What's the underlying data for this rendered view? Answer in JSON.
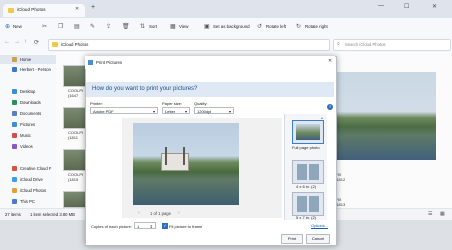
{
  "explorer": {
    "tab_title": "iCloud Photos",
    "toolbar": {
      "new_label": "New",
      "sort_label": "Sort",
      "view_label": "View",
      "set_background_label": "Set as background",
      "rotate_left_label": "Rotate left",
      "rotate_right_label": "Rotate right"
    },
    "address": "iCloud Photos",
    "search_placeholder": "Search iCloud Photos",
    "sidebar": [
      {
        "label": "Home",
        "color": "#c9a24b"
      },
      {
        "label": "Herbert - Person",
        "color": "#3a78c8"
      },
      {
        "label": "Desktop",
        "color": "#3a8fd6"
      },
      {
        "label": "Downloads",
        "color": "#2a8f5a"
      },
      {
        "label": "Documents",
        "color": "#5b7fbf"
      },
      {
        "label": "Pictures",
        "color": "#3c8edb"
      },
      {
        "label": "Music",
        "color": "#d0504a"
      },
      {
        "label": "Videos",
        "color": "#8a58c4"
      },
      {
        "label": "Creative Cloud F",
        "color": "#d9533f"
      },
      {
        "label": "iCloud Drive",
        "color": "#3a9ee8"
      },
      {
        "label": "iCloud Photos",
        "color": "#e0a33a"
      },
      {
        "label": "This PC",
        "color": "#4a7bd0"
      },
      {
        "label": "Network",
        "color": "#4a7bd0"
      }
    ],
    "file_labels": [
      "COOLPI",
      "COOLPI",
      "COOLPI",
      "COOLPI"
    ],
    "file_subs": [
      "(1647",
      "(1811",
      "(1815",
      ""
    ],
    "right_labels": [
      "PIX",
      "PIX",
      "PIX",
      "PIX"
    ],
    "right_subs": [
      "(1647",
      "(1811",
      "(1812",
      "(1813"
    ],
    "status": {
      "items": "27 items",
      "selected": "1 item selected  3.80 MB"
    }
  },
  "dialog": {
    "title": "Print Pictures",
    "question": "How do you want to print your pictures?",
    "printer_label": "Printer:",
    "printer_value": "Adobe PDF",
    "paper_size_label": "Paper size:",
    "paper_size_value": "Letter",
    "quality_label": "Quality:",
    "quality_value": "1200dpi",
    "page_indicator": "1 of 1 page",
    "layouts": [
      {
        "label": "Full page photo",
        "selected": true
      },
      {
        "label": "4 x 6 in. (2)",
        "selected": false
      },
      {
        "label": "5 x 7 in. (2)",
        "selected": false
      }
    ],
    "copies_label": "Copies of each picture:",
    "copies_value": "1",
    "fit_label": "Fit picture to frame",
    "options_link": "Options...",
    "print_button": "Print",
    "cancel_button": "Cancel"
  }
}
